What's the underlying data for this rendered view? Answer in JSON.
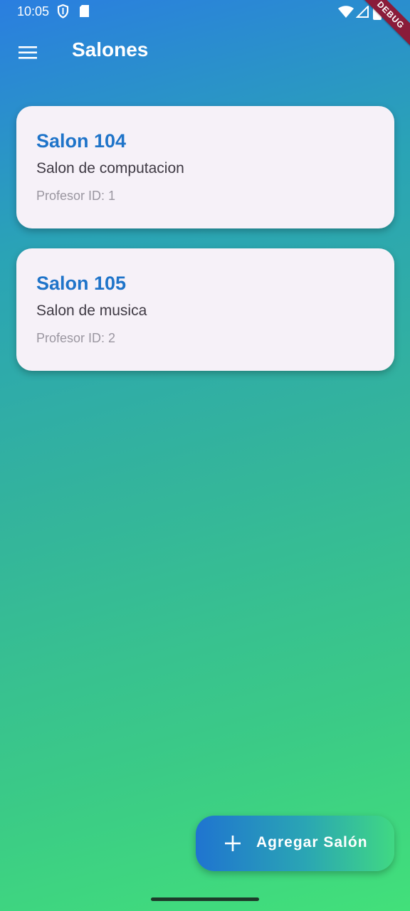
{
  "status_bar": {
    "time": "10:05",
    "icons": [
      "shield-icon",
      "sd-card-icon",
      "wifi-icon",
      "signal-icon",
      "battery-icon"
    ],
    "debug_label": "DEBUG"
  },
  "app_bar": {
    "menu_icon": "menu-icon",
    "title": "Salones"
  },
  "salones": [
    {
      "title": "Salon 104",
      "description": "Salon de computacion",
      "profesor": "Profesor ID: 1"
    },
    {
      "title": "Salon 105",
      "description": "Salon de musica",
      "profesor": "Profesor ID: 2"
    }
  ],
  "fab": {
    "icon": "plus-icon",
    "label": "Agregar Salón"
  },
  "colors": {
    "gradient_top": "#2a7ee0",
    "gradient_bottom": "#42e07a",
    "card_bg": "#f6f1f8",
    "card_title": "#1f74c9",
    "debug_banner": "#8a1c3a"
  }
}
